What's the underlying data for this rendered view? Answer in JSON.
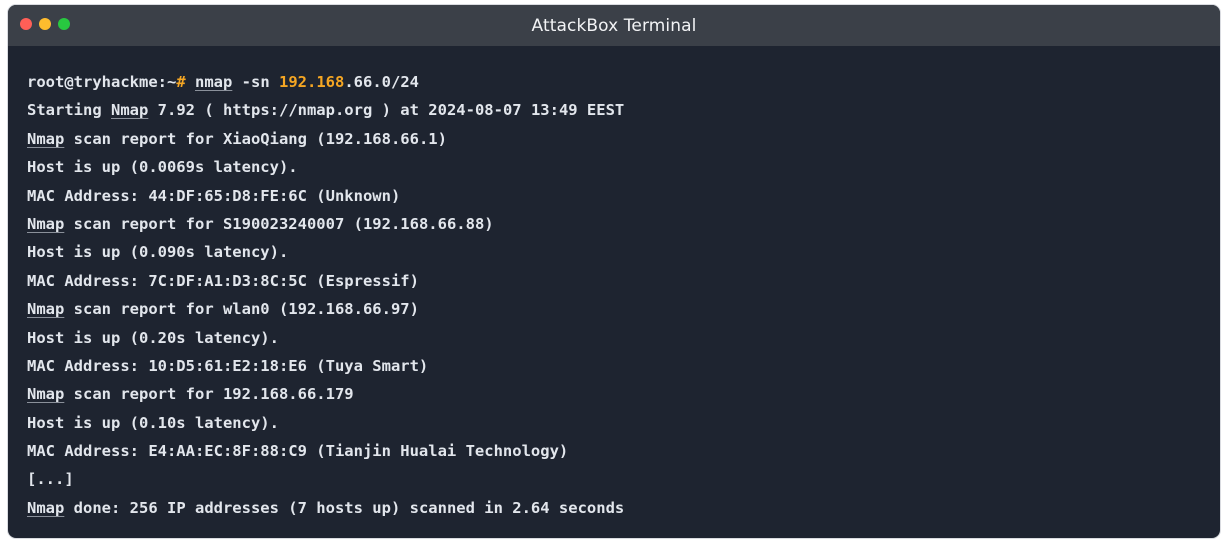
{
  "window": {
    "title": "AttackBox Terminal",
    "traffic_lights": [
      {
        "name": "close",
        "color": "#ff5f57"
      },
      {
        "name": "minimize",
        "color": "#febc2e"
      },
      {
        "name": "maximize",
        "color": "#28c840"
      }
    ]
  },
  "terminal": {
    "prompt": {
      "user_host": "root@tryhackme:~",
      "symbol": "#",
      "cmd": "nmap",
      "flag": "-sn",
      "ip_highlight": "192.168",
      "ip_rest": ".66.0/24"
    },
    "starting": {
      "word": "Starting",
      "nmap": "Nmap",
      "rest": "7.92 ( https://nmap.org ) at 2024-08-07 13:49 EEST"
    },
    "hosts": [
      {
        "report_prefix": "Nmap",
        "report_rest": "scan report for XiaoQiang (192.168.66.1)",
        "status": "Host is up (0.0069s latency).",
        "mac": "MAC Address: 44:DF:65:D8:FE:6C (Unknown)"
      },
      {
        "report_prefix": "Nmap",
        "report_rest": "scan report for S190023240007 (192.168.66.88)",
        "status": "Host is up (0.090s latency).",
        "mac": "MAC Address: 7C:DF:A1:D3:8C:5C (Espressif)"
      },
      {
        "report_prefix": "Nmap",
        "report_rest": "scan report for wlan0 (192.168.66.97)",
        "status": "Host is up (0.20s latency).",
        "mac": "MAC Address: 10:D5:61:E2:18:E6 (Tuya Smart)"
      },
      {
        "report_prefix": "Nmap",
        "report_rest": "scan report for 192.168.66.179",
        "status": "Host is up (0.10s latency).",
        "mac": "MAC Address: E4:AA:EC:8F:88:C9 (Tianjin Hualai Technology)"
      }
    ],
    "ellipsis": "[...]",
    "done": {
      "nmap": "Nmap",
      "rest": "done: 256 IP addresses (7 hosts up) scanned in 2.64 seconds"
    }
  },
  "colors": {
    "background": "#1e2430",
    "titlebar": "#3b4048",
    "text": "#e2e6ec",
    "highlight": "#f5a623"
  }
}
